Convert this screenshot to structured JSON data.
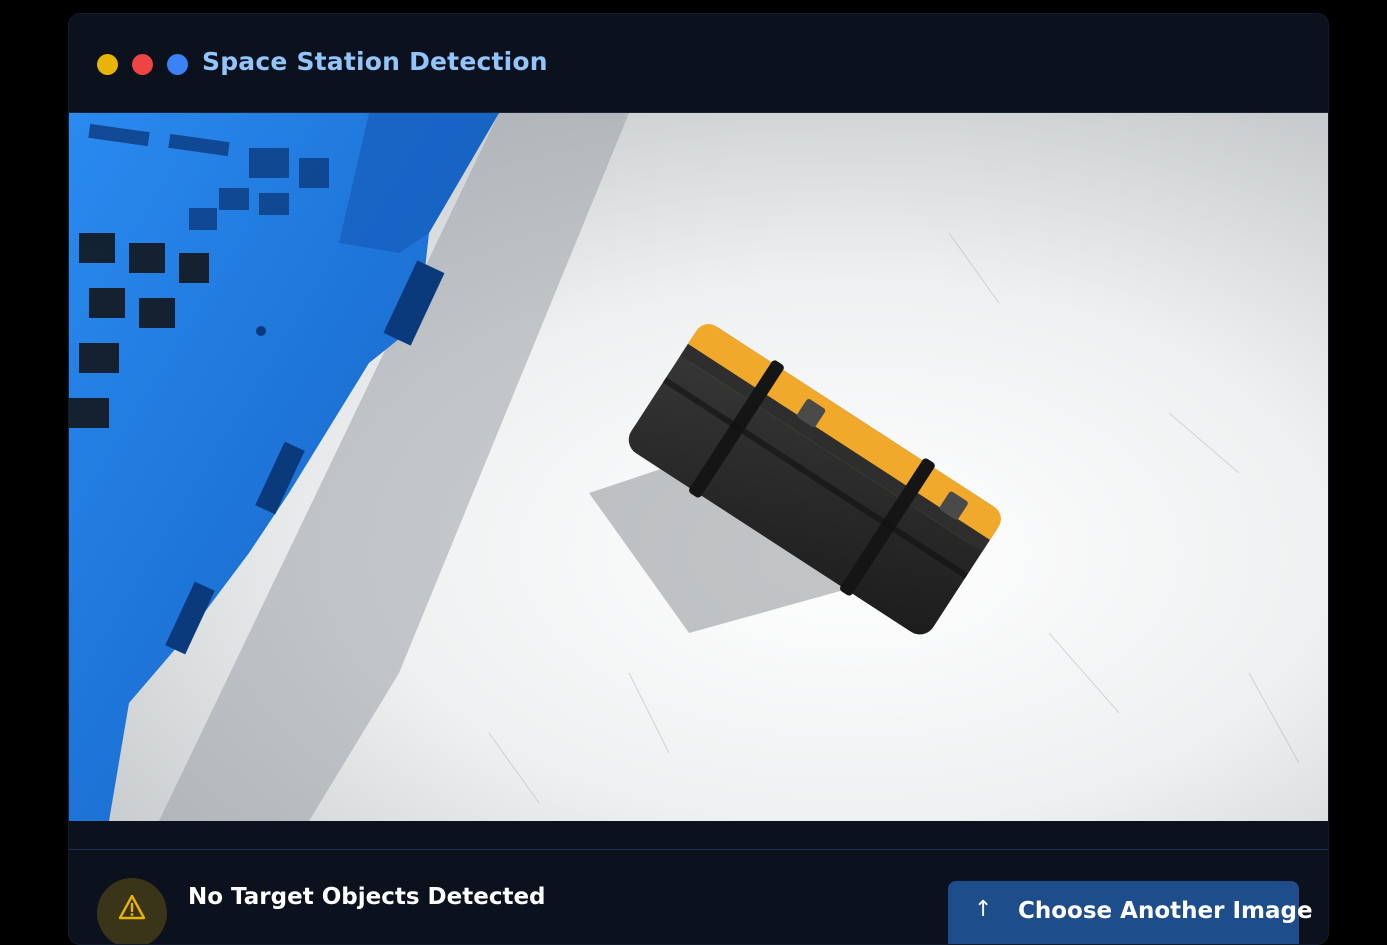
{
  "header": {
    "title": "Space Station Detection",
    "window_dots": [
      "yellow",
      "red",
      "blue"
    ]
  },
  "image": {
    "icons": [
      "blue-pallet",
      "toolbox"
    ]
  },
  "status": {
    "title": "No Target Objects Detected",
    "icon": "warning-icon"
  },
  "actions": {
    "choose_label": "Choose Another Image",
    "choose_icon": "upload-arrow-icon"
  },
  "colors": {
    "background": "#000000",
    "panel": "#0b111d",
    "title": "#93c5fd",
    "button": "#1e4d8c",
    "warning": "#eab308",
    "pallet": "#1a72d6",
    "toolbox_body": "#2a2a2a",
    "toolbox_lid": "#f0a92a"
  }
}
